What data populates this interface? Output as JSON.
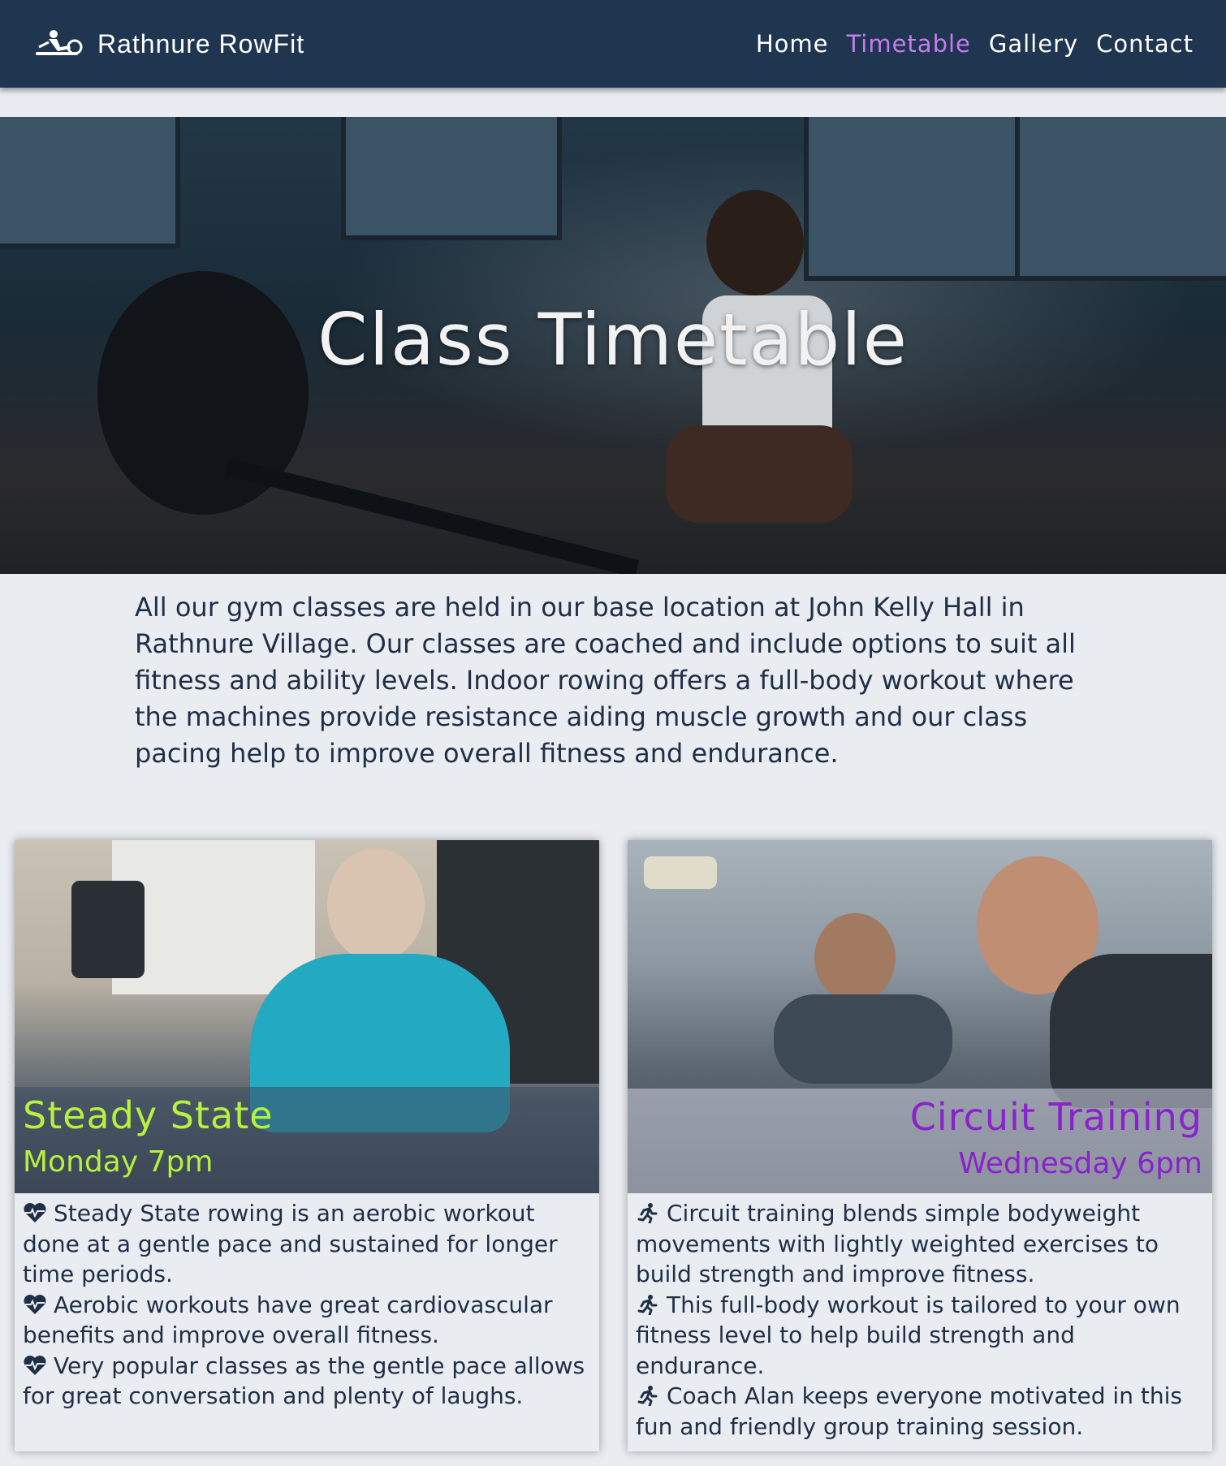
{
  "brand": {
    "name": "Rathnure RowFit",
    "icon": "rower-icon"
  },
  "nav": [
    {
      "label": "Home",
      "active": false
    },
    {
      "label": "Timetable",
      "active": true
    },
    {
      "label": "Gallery",
      "active": false
    },
    {
      "label": "Contact",
      "active": false
    }
  ],
  "colors": {
    "navbar": "#1f3550",
    "active_link": "#c77bf0",
    "steady_state_title": "#b6f13f",
    "circuit_title": "#8a22cc",
    "page_bg": "#e9ecf1"
  },
  "hero": {
    "title": "Class Timetable"
  },
  "intro": "All our gym classes are held in our base location at John Kelly Hall in Rathnure Village. Our classes are coached and include options to suit all fitness and ability levels. Indoor rowing offers a full-body workout where the machines provide resistance aiding muscle growth and our class pacing help to improve overall fitness and endurance.",
  "classes": [
    {
      "title": "Steady State",
      "time": "Monday 7pm",
      "icon": "heartbeat-icon",
      "points": [
        "Steady State rowing is an aerobic workout done at a gentle pace and sustained for longer time periods.",
        "Aerobic workouts have great cardiovascular benefits and improve overall fitness.",
        "Very popular classes as the gentle pace allows for great conversation and plenty of laughs."
      ]
    },
    {
      "title": "Circuit Training",
      "time": "Wednesday 6pm",
      "icon": "running-icon",
      "points": [
        "Circuit training blends simple bodyweight movements with lightly weighted exercises to build strength and improve fitness.",
        "This full-body workout is tailored to your own fitness level to help build strength and endurance.",
        "Coach Alan keeps everyone motivated in this fun and friendly group training session."
      ]
    }
  ]
}
